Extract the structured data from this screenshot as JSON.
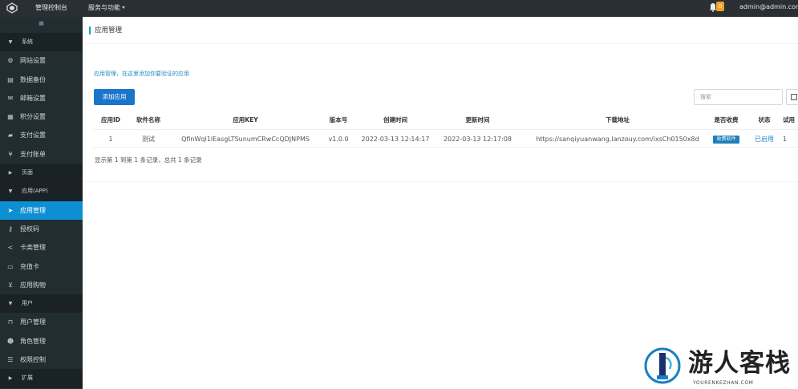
{
  "topbar": {
    "brand": "管理控制台",
    "nav_services": "服务与功能",
    "notification_count": "0",
    "user_email": "admin@admin.com"
  },
  "sidebar": {
    "toggle": "≡",
    "items": [
      {
        "label": "系统",
        "type": "header",
        "icon": "caret-down-icon"
      },
      {
        "label": "网站设置",
        "icon": "gear-icon"
      },
      {
        "label": "数据备份",
        "icon": "database-icon"
      },
      {
        "label": "邮箱设置",
        "icon": "envelope-icon"
      },
      {
        "label": "积分设置",
        "icon": "points-icon"
      },
      {
        "label": "支付设置",
        "icon": "wallet-icon"
      },
      {
        "label": "支付账单",
        "icon": "yen-icon"
      },
      {
        "label": "页面",
        "type": "header",
        "icon": "caret-right-icon"
      },
      {
        "label": "应用(APP)",
        "type": "header",
        "icon": "caret-down-icon"
      },
      {
        "label": "应用管理",
        "icon": "send-icon",
        "active": true
      },
      {
        "label": "授权码",
        "icon": "key-icon"
      },
      {
        "label": "卡类管理",
        "icon": "share-icon"
      },
      {
        "label": "充值卡",
        "icon": "card-icon"
      },
      {
        "label": "应用购物",
        "icon": "cart-icon"
      },
      {
        "label": "用户",
        "type": "header",
        "icon": "caret-down-icon"
      },
      {
        "label": "用户管理",
        "icon": "lock-icon"
      },
      {
        "label": "角色管理",
        "icon": "users-icon"
      },
      {
        "label": "权限控制",
        "icon": "list-icon"
      },
      {
        "label": "扩展",
        "type": "header",
        "icon": "caret-right-icon"
      }
    ]
  },
  "main": {
    "page_title": "应用管理",
    "hint": "应用管理，在这里添加你要验证的应用",
    "add_button": "添加应用",
    "search_placeholder": "搜索",
    "table": {
      "columns": [
        "应用ID",
        "软件名称",
        "应用KEY",
        "版本号",
        "创建时间",
        "更新时间",
        "下载地址",
        "是否收费",
        "状态",
        "试用"
      ],
      "rows": [
        {
          "id": "1",
          "name": "测试",
          "key": "QfinWqI1lEasgLTSunumCRwCcQDJNPMS",
          "version": "v1.0.0",
          "created": "2022-03-13 12:14:17",
          "updated": "2022-03-13 12:17:08",
          "url": "https://sanqiyuanwang.lanzouy.com/ixsCh0150x8d",
          "charge": "收费软件",
          "status": "已启用",
          "trial": "1"
        }
      ]
    },
    "pager_info": "显示第 1 到第 1 条记录，总共 1 条记录"
  },
  "watermark": {
    "text": "游人客栈",
    "domain": "YOURENKEZHAN.COM"
  },
  "colors": {
    "topbar": "#2a2f34",
    "sidebar": "#222d32",
    "active": "#0e8fd3",
    "primary_button": "#1975c9",
    "link": "#2a8bbf"
  }
}
